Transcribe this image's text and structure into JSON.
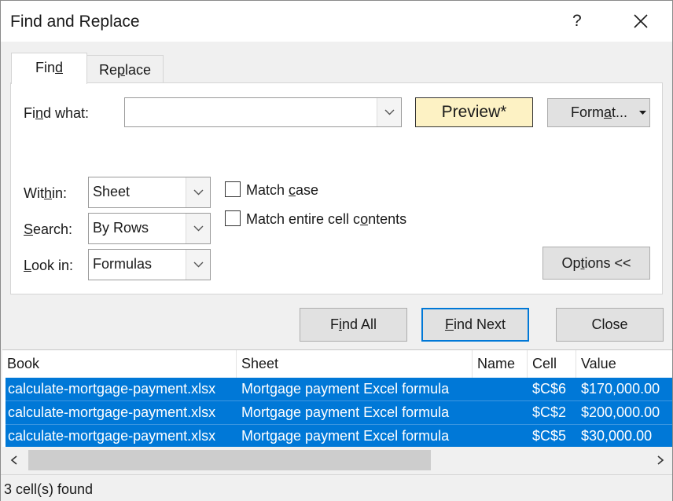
{
  "window": {
    "title": "Find and Replace",
    "help_label": "?"
  },
  "tabs": [
    {
      "label_pre": "Fin",
      "label_u": "d",
      "label_post": "",
      "active": true
    },
    {
      "label_pre": "Re",
      "label_u": "p",
      "label_post": "lace",
      "active": false
    }
  ],
  "find": {
    "label_pre": "Fi",
    "label_u": "n",
    "label_post": "d what:",
    "value": "",
    "preview_label": "Preview*",
    "format_pre": "Form",
    "format_u": "a",
    "format_post": "t..."
  },
  "within": {
    "label_pre": "Wit",
    "label_u": "h",
    "label_post": "in:",
    "value": "Sheet"
  },
  "search": {
    "label_pre": "",
    "label_u": "S",
    "label_post": "earch:",
    "value": "By Rows"
  },
  "look_in": {
    "label_pre": "",
    "label_u": "L",
    "label_post": "ook in:",
    "value": "Formulas"
  },
  "match_case": {
    "label_pre": "Match ",
    "label_u": "c",
    "label_post": "ase",
    "checked": false
  },
  "match_entire": {
    "label_pre": "Match entire cell c",
    "label_u": "o",
    "label_post": "ntents",
    "checked": false
  },
  "buttons": {
    "options_pre": "Op",
    "options_u": "t",
    "options_post": "ions <<",
    "find_all_pre": "F",
    "find_all_u": "i",
    "find_all_post": "nd All",
    "find_next_pre": "",
    "find_next_u": "F",
    "find_next_post": "ind Next",
    "close": "Close"
  },
  "results": {
    "columns": [
      "Book",
      "Sheet",
      "Name",
      "Cell",
      "Value"
    ],
    "rows": [
      {
        "book": "calculate-mortgage-payment.xlsx",
        "sheet": "Mortgage payment Excel formula",
        "name": "",
        "cell": "$C$6",
        "value": "$170,000.00"
      },
      {
        "book": "calculate-mortgage-payment.xlsx",
        "sheet": "Mortgage payment Excel formula",
        "name": "",
        "cell": "$C$2",
        "value": "$200,000.00"
      },
      {
        "book": "calculate-mortgage-payment.xlsx",
        "sheet": "Mortgage payment Excel formula",
        "name": "",
        "cell": "$C$5",
        "value": "$30,000.00"
      }
    ],
    "selection_color": "#0078d7"
  },
  "status": "3 cell(s) found",
  "icons": {
    "close": "close-x-icon",
    "dropdown": "chevron-down-icon",
    "format_dropdown": "caret-down-icon",
    "scroll_left": "chevron-left-icon",
    "scroll_right": "chevron-right-icon"
  },
  "colors": {
    "accent": "#0078d7",
    "preview_bg": "#fdf2c4",
    "dialog_bg": "#f0f0f0"
  }
}
